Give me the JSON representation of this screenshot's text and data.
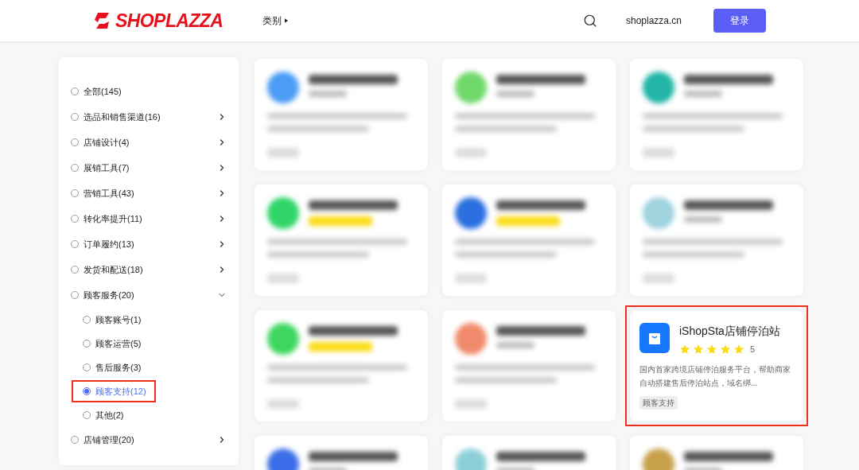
{
  "header": {
    "logo": "SHOPLAZZA",
    "nav": [
      {
        "label": "类别"
      }
    ],
    "domain": "shoplazza.cn",
    "login": "登录"
  },
  "sidebar": {
    "items": [
      {
        "label": "全部(145)",
        "selected": false
      },
      {
        "label": "选品和销售渠道(16)",
        "selected": false,
        "expanded": false
      },
      {
        "label": "店铺设计(4)",
        "selected": false,
        "expanded": false
      },
      {
        "label": "展销工具(7)",
        "selected": false,
        "expanded": false
      },
      {
        "label": "营销工具(43)",
        "selected": false,
        "expanded": false
      },
      {
        "label": "转化率提升(11)",
        "selected": false,
        "expanded": false
      },
      {
        "label": "订单履约(13)",
        "selected": false,
        "expanded": false
      },
      {
        "label": "发货和配送(18)",
        "selected": false,
        "expanded": false
      },
      {
        "label": "顾客服务(20)",
        "selected": false,
        "expanded": true,
        "children": [
          {
            "label": "顾客账号(1)",
            "selected": false,
            "highlighted": false
          },
          {
            "label": "顾客运营(5)",
            "selected": false,
            "highlighted": false
          },
          {
            "label": "售后服务(3)",
            "selected": false,
            "highlighted": false
          },
          {
            "label": "顾客支持(12)",
            "selected": true,
            "highlighted": true
          },
          {
            "label": "其他(2)",
            "selected": false,
            "highlighted": false
          }
        ]
      },
      {
        "label": "店铺管理(20)",
        "selected": false,
        "expanded": false
      }
    ]
  },
  "cards": [
    {
      "kind": "blurred",
      "color": "#4a9cf5",
      "rated": false
    },
    {
      "kind": "blurred",
      "color": "#6fd86a",
      "rated": false
    },
    {
      "kind": "blurred",
      "color": "#22b5a8",
      "rated": false
    },
    {
      "kind": "blurred",
      "color": "#2fd566",
      "rated": true
    },
    {
      "kind": "blurred",
      "color": "#2b6fe0",
      "rated": true
    },
    {
      "kind": "blurred",
      "color": "#9fd3de",
      "rated": false
    },
    {
      "kind": "blurred",
      "color": "#3ed65f",
      "rated": true
    },
    {
      "kind": "blurred",
      "color": "#f08a6a",
      "rated": false
    },
    {
      "kind": "app",
      "name": "iShopSta店铺停泊站",
      "stars": 5,
      "rating": "5",
      "description": "国内首家跨境店铺停泊服务平台，帮助商家自动搭建售后停泊站点，域名绑...",
      "tag": "顾客支持",
      "highlighted": true
    },
    {
      "kind": "blurred",
      "color": "#3b6ee8"
    },
    {
      "kind": "blurred",
      "color": "#8ed0d8"
    },
    {
      "kind": "blurred",
      "color": "#c9a04a"
    }
  ]
}
